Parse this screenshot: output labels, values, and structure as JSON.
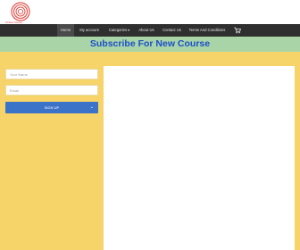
{
  "header": {
    "logo_icon": "concentric-circles-logo-icon",
    "logo_text": "Online Course"
  },
  "nav": {
    "items": [
      {
        "label": "Home"
      },
      {
        "label": "My account"
      },
      {
        "label": "Categories"
      },
      {
        "label": "About Us"
      },
      {
        "label": "Contact Us"
      },
      {
        "label": "Terms And Conditions"
      }
    ],
    "categories_caret": "▾",
    "cart_icon": "cart-icon"
  },
  "banner": {
    "title": "Subscribe For New Course"
  },
  "form": {
    "name_placeholder": "Your Name",
    "email_placeholder": "Email",
    "submit_label": "SIGN UP",
    "submit_caret": "⌄"
  },
  "colors": {
    "nav_bg": "#2f2f2f",
    "banner_bg": "#a9d4a8",
    "title": "#1a4fc8",
    "main_bg": "#f7d46a",
    "button": "#3b73c9"
  }
}
